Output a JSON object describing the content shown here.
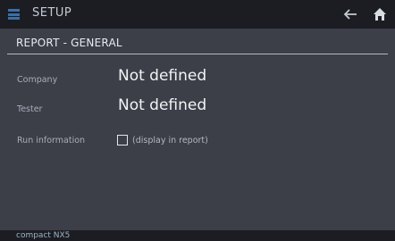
{
  "header": {
    "title": "SETUP",
    "menu_icon": "list-icon",
    "back_icon": "arrow-left-icon",
    "home_icon": "home-icon"
  },
  "section": {
    "title": "REPORT - GENERAL"
  },
  "fields": [
    {
      "label": "Company",
      "value": "Not defined"
    },
    {
      "label": "Tester",
      "value": "Not defined"
    }
  ],
  "run_info": {
    "label": "Run information",
    "checkbox_text": "(display in report)",
    "checked": false
  },
  "footer": {
    "device": "compact NX5"
  },
  "colors": {
    "topbar": "#1b1d22",
    "background": "#3c3e48",
    "accent": "#3c6fa5"
  }
}
